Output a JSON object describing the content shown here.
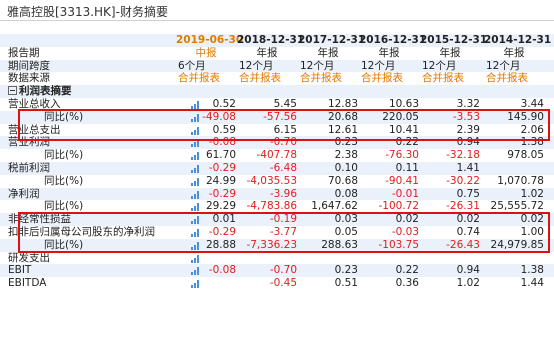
{
  "title": "雅高控股[3313.HK]-财务摘要",
  "headers": {
    "label_report_date": "报告期",
    "dates": [
      "2019-06-30",
      "2018-12-31",
      "2017-12-31",
      "2016-12-31",
      "2015-12-31",
      "2014-12-31"
    ],
    "label_period_type": "报告期",
    "period_types": [
      "中报",
      "年报",
      "年报",
      "年报",
      "年报",
      "年报"
    ],
    "label_span": "期间跨度",
    "spans": [
      "6个月",
      "12个月",
      "12个月",
      "12个月",
      "12个月",
      "12个月"
    ],
    "label_source": "数据来源",
    "sources": [
      "合并报表",
      "合并报表",
      "合并报表",
      "合并报表",
      "合并报表",
      "合并报表"
    ]
  },
  "section_title": "利润表摘要",
  "rows": [
    {
      "label": "营业总收入",
      "values": [
        "0.52",
        "5.45",
        "12.83",
        "10.63",
        "3.32",
        "3.44"
      ],
      "neg": [
        false,
        false,
        false,
        false,
        false,
        false
      ]
    },
    {
      "label": "同比(%)",
      "values": [
        "-49.08",
        "-57.56",
        "20.68",
        "220.05",
        "-3.53",
        "145.90"
      ],
      "neg": [
        true,
        true,
        false,
        false,
        true,
        false
      ]
    },
    {
      "label": "营业总支出",
      "values": [
        "0.59",
        "6.15",
        "12.61",
        "10.41",
        "2.39",
        "2.06"
      ],
      "neg": [
        false,
        false,
        false,
        false,
        false,
        false
      ]
    },
    {
      "label": "营业利润",
      "values": [
        "-0.08",
        "-0.70",
        "0.23",
        "0.22",
        "0.94",
        "1.38"
      ],
      "neg": [
        true,
        true,
        false,
        false,
        false,
        false
      ]
    },
    {
      "label": "同比(%)",
      "values": [
        "61.70",
        "-407.78",
        "2.38",
        "-76.30",
        "-32.18",
        "978.05"
      ],
      "neg": [
        false,
        true,
        false,
        true,
        true,
        false
      ]
    },
    {
      "label": "税前利润",
      "values": [
        "-0.29",
        "-6.48",
        "0.10",
        "0.11",
        "1.41",
        ""
      ],
      "neg": [
        true,
        true,
        false,
        false,
        false,
        false
      ]
    },
    {
      "label": "同比(%)",
      "values": [
        "24.99",
        "-4,035.53",
        "70.68",
        "-90.41",
        "-30.22",
        "1,070.78"
      ],
      "neg": [
        false,
        true,
        false,
        true,
        true,
        false
      ]
    },
    {
      "label": "净利润",
      "values": [
        "-0.29",
        "-3.96",
        "0.08",
        "-0.01",
        "0.75",
        "1.02"
      ],
      "neg": [
        true,
        true,
        false,
        true,
        false,
        false
      ]
    },
    {
      "label": "同比(%)",
      "values": [
        "29.29",
        "-4,783.86",
        "1,647.62",
        "-100.72",
        "-26.31",
        "25,555.72"
      ],
      "neg": [
        false,
        true,
        false,
        true,
        true,
        false
      ]
    },
    {
      "label": "非经常性损益",
      "values": [
        "0.01",
        "-0.19",
        "0.03",
        "0.02",
        "0.02",
        "0.02"
      ],
      "neg": [
        false,
        true,
        false,
        false,
        false,
        false
      ]
    },
    {
      "label": "扣非后归属母公司股东的净利润",
      "values": [
        "-0.29",
        "-3.77",
        "0.05",
        "-0.03",
        "0.74",
        "1.00"
      ],
      "neg": [
        true,
        true,
        false,
        true,
        false,
        false
      ]
    },
    {
      "label": "同比(%)",
      "values": [
        "28.88",
        "-7,336.23",
        "288.63",
        "-103.75",
        "-26.43",
        "24,979.85"
      ],
      "neg": [
        false,
        true,
        false,
        true,
        true,
        false
      ]
    },
    {
      "label": "研发支出",
      "values": [
        "",
        "",
        "",
        "",
        "",
        ""
      ],
      "neg": [
        false,
        false,
        false,
        false,
        false,
        false
      ]
    },
    {
      "label": "EBIT",
      "values": [
        "-0.08",
        "-0.70",
        "0.23",
        "0.22",
        "0.94",
        "1.38"
      ],
      "neg": [
        true,
        true,
        false,
        false,
        false,
        false
      ]
    },
    {
      "label": "EBITDA",
      "values": [
        "",
        "-0.45",
        "0.51",
        "0.36",
        "1.02",
        "1.44"
      ],
      "neg": [
        false,
        true,
        false,
        false,
        false,
        false
      ]
    }
  ],
  "colors": {
    "negative": "#e21d1d",
    "accent": "#e07a00",
    "shade": "#eaf1fb",
    "box": "#e01010",
    "icon": "#4a90d9"
  }
}
